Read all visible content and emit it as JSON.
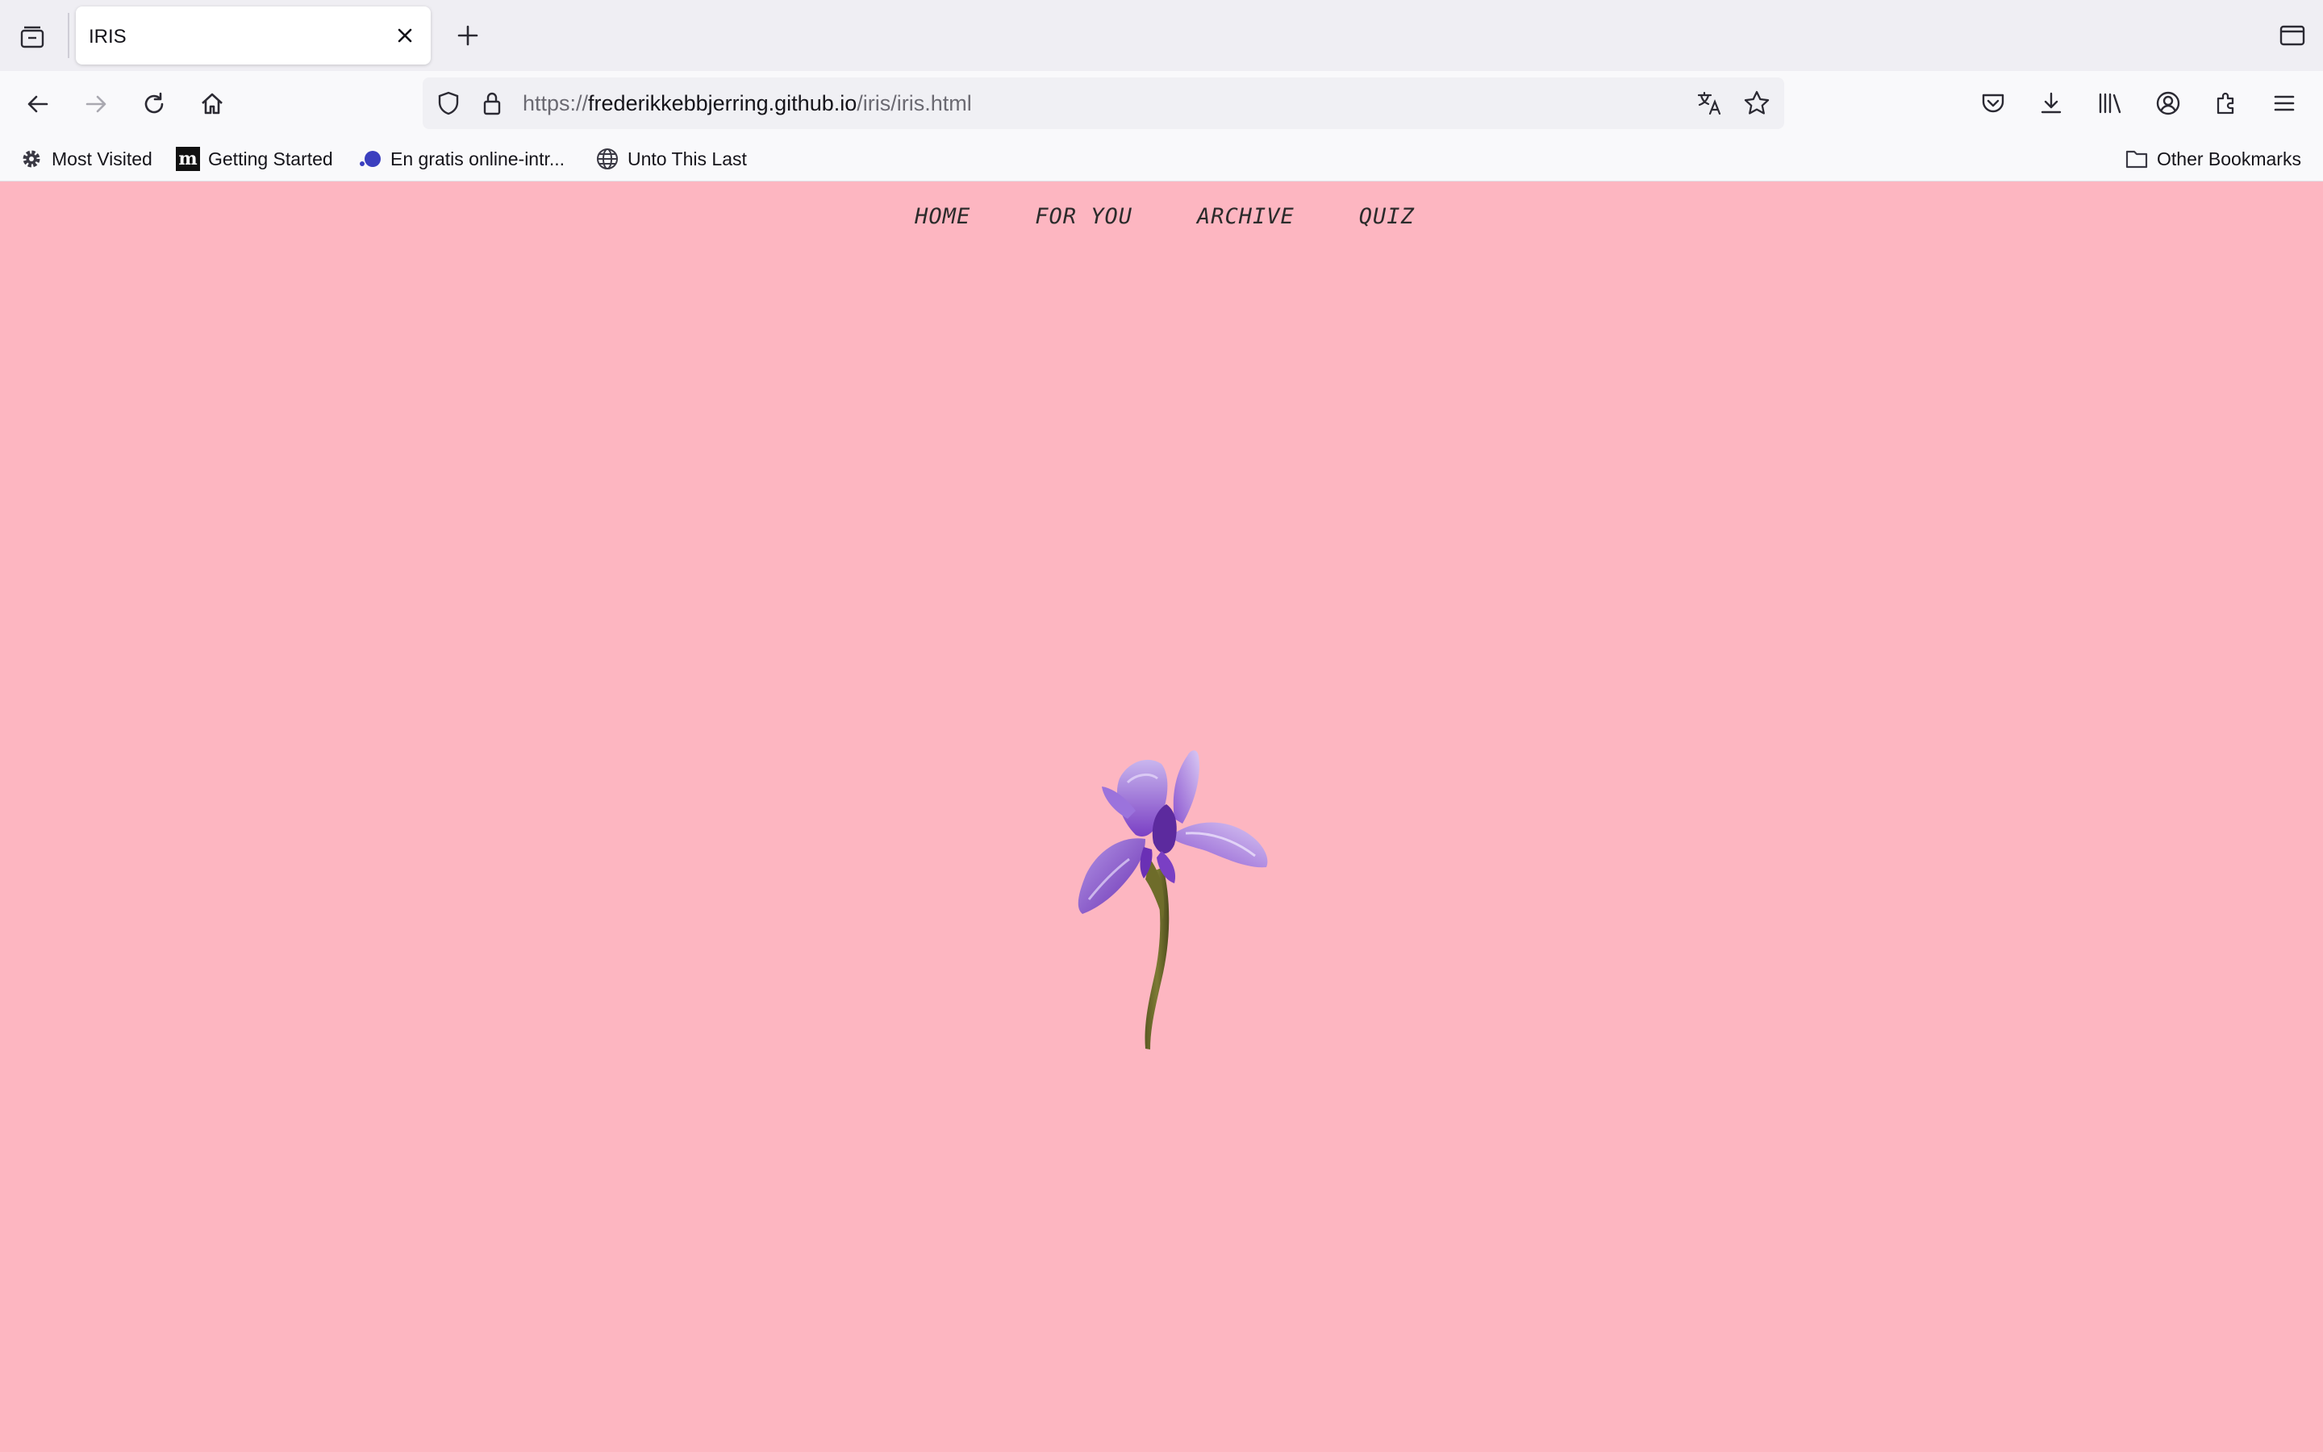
{
  "tab": {
    "title": "IRIS"
  },
  "address_bar": {
    "url_prefix": "https://",
    "url_domain": "frederikkebbjerring.github.io",
    "url_path": "/iris/iris.html"
  },
  "bookmarks": {
    "items": [
      {
        "label": "Most Visited",
        "icon": "gear-icon"
      },
      {
        "label": "Getting Started",
        "icon": "m-logo-icon"
      },
      {
        "label": "En gratis online-intr...",
        "icon": "dot-logo-icon"
      },
      {
        "label": "Unto This Last",
        "icon": "globe-icon"
      }
    ],
    "other": "Other Bookmarks"
  },
  "site_nav": {
    "items": [
      "HOME",
      "FOR YOU",
      "ARCHIVE",
      "QUIZ"
    ]
  },
  "colors": {
    "page_background": "#fdb6c1",
    "nav_text": "#2b2b2b",
    "chrome_background": "#f9f9fb",
    "tabstrip_background": "#efeef3"
  },
  "image": {
    "subject": "iris-flower-illustration"
  }
}
